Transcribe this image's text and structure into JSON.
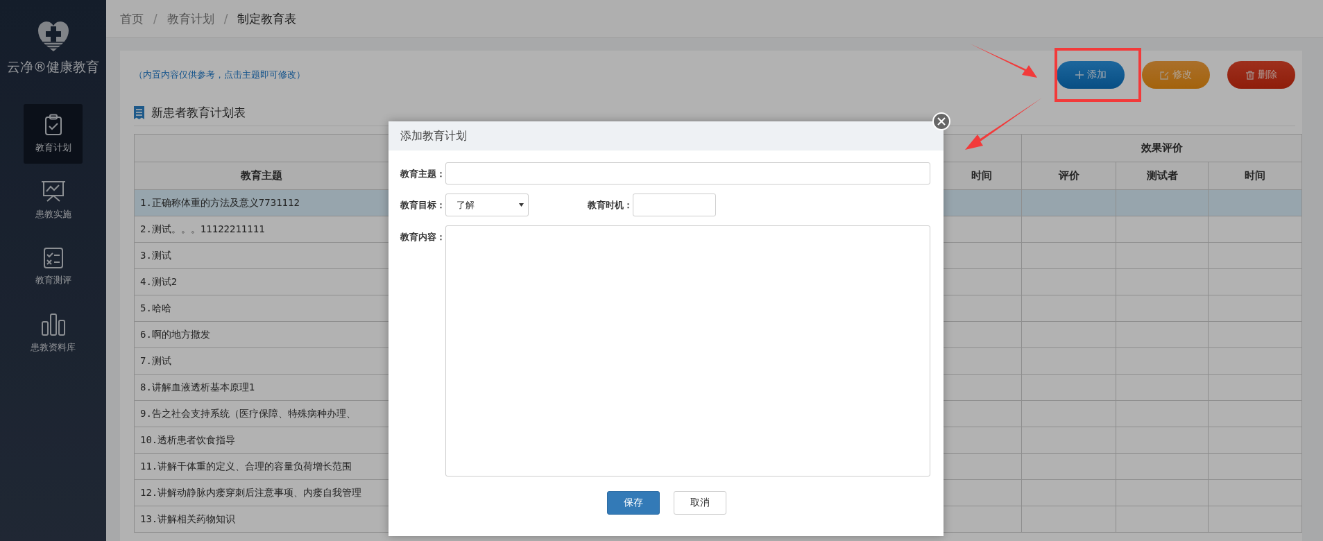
{
  "sidebar": {
    "brand": "云净®健康教育",
    "items": [
      {
        "label": "教育计划",
        "selected": true
      },
      {
        "label": "患教实施",
        "selected": false
      },
      {
        "label": "教育测评",
        "selected": false
      },
      {
        "label": "患教资料库",
        "selected": false
      }
    ]
  },
  "breadcrumb": {
    "separator": "/",
    "items": [
      {
        "label": "首页",
        "current": false
      },
      {
        "label": "教育计划",
        "current": false
      },
      {
        "label": "制定教育表",
        "current": true
      }
    ]
  },
  "hint": "（内置内容仅供参考，点击主题即可修改）",
  "toolbar": [
    {
      "label": "添加",
      "kind": "add"
    },
    {
      "label": "修改",
      "kind": "edit"
    },
    {
      "label": "删除",
      "kind": "delete"
    }
  ],
  "table": {
    "title": "新患者教育计划表",
    "group_header": "效果评价",
    "columns": [
      "教育主题",
      "时间",
      "评价",
      "测试者",
      "时间"
    ],
    "rows": [
      {
        "topic": "1.正确称体重的方法及意义7731112",
        "selected": true
      },
      {
        "topic": "2.测试。。。11122211111",
        "selected": false
      },
      {
        "topic": "3.测试",
        "selected": false
      },
      {
        "topic": "4.测试2",
        "selected": false
      },
      {
        "topic": "5.哈哈",
        "selected": false
      },
      {
        "topic": "6.啊的地方撒发",
        "selected": false
      },
      {
        "topic": "7.测试",
        "selected": false
      },
      {
        "topic": "8.讲解血液透析基本原理1",
        "selected": false
      },
      {
        "topic": "9.告之社会支持系统（医疗保障、特殊病种办理、",
        "selected": false
      },
      {
        "topic": "10.透析患者饮食指导",
        "selected": false
      },
      {
        "topic": "11.讲解干体重的定义、合理的容量负荷增长范围",
        "selected": false
      },
      {
        "topic": "12.讲解动静脉内瘘穿刺后注意事项、内瘘自我管理",
        "selected": false
      },
      {
        "topic": "13.讲解相关药物知识",
        "selected": false
      }
    ]
  },
  "dialog": {
    "title": "添加教育计划",
    "topic_label": "教育主题：",
    "goal_label": "教育目标：",
    "goal_value": "了解",
    "timing_label": "教育时机：",
    "content_label": "教育内容：",
    "save": "保存",
    "cancel": "取消"
  }
}
